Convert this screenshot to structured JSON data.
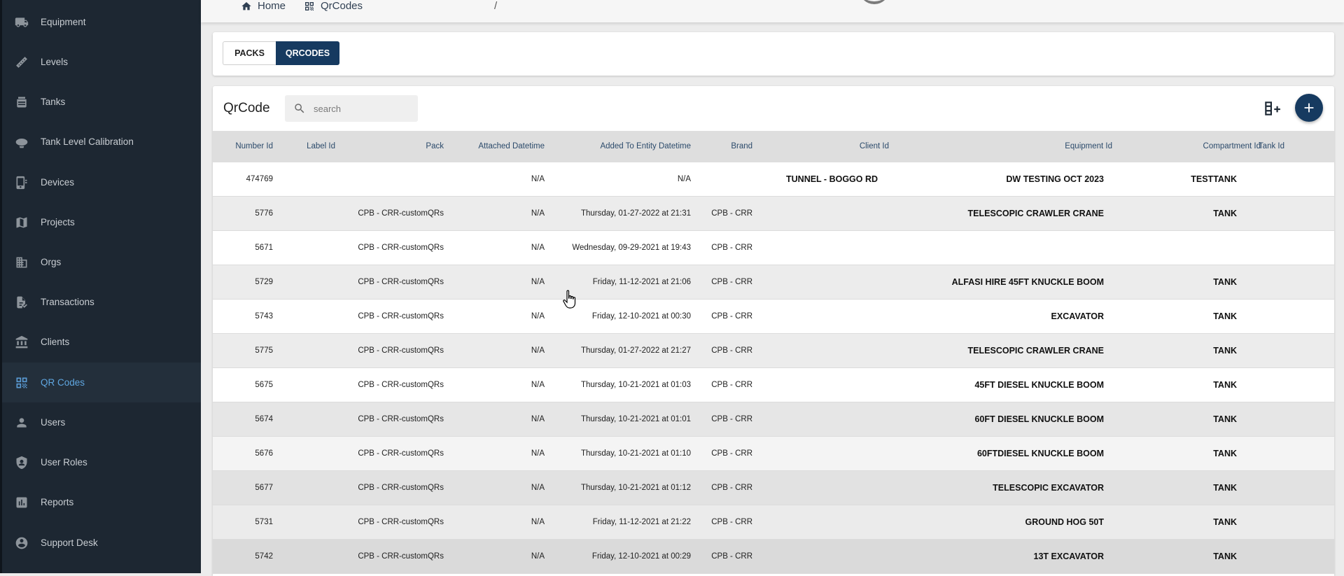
{
  "sidebar": {
    "items": [
      {
        "label": "Equipment",
        "icon": "truck-icon",
        "active": false
      },
      {
        "label": "Levels",
        "icon": "ruler-icon",
        "active": false
      },
      {
        "label": "Tanks",
        "icon": "tank-icon",
        "active": false
      },
      {
        "label": "Tank Level Calibration",
        "icon": "blimp-icon",
        "active": false
      },
      {
        "label": "Devices",
        "icon": "device-icon",
        "active": false
      },
      {
        "label": "Projects",
        "icon": "map-icon",
        "active": false
      },
      {
        "label": "Orgs",
        "icon": "building-icon",
        "active": false
      },
      {
        "label": "Transactions",
        "icon": "receipt-icon",
        "active": false
      },
      {
        "label": "Clients",
        "icon": "bank-icon",
        "active": false
      },
      {
        "label": "QR Codes",
        "icon": "qrcode-icon",
        "active": true
      },
      {
        "label": "Users",
        "icon": "person-icon",
        "active": false
      },
      {
        "label": "User Roles",
        "icon": "shield-icon",
        "active": false
      },
      {
        "label": "Reports",
        "icon": "chart-icon",
        "active": false
      },
      {
        "label": "Support Desk",
        "icon": "support-icon",
        "active": false
      }
    ]
  },
  "breadcrumb": {
    "home": "Home",
    "separator": "/",
    "current": "QrCodes"
  },
  "tabs": {
    "packs": "PACKS",
    "qrcodes": "QRCODES",
    "active": "QRCODES"
  },
  "main": {
    "title": "QrCode",
    "search_placeholder": "search",
    "search_value": ""
  },
  "colors": {
    "sidebar_bg": "#1d2732",
    "accent": "#163a60",
    "active_nav": "#5fa6e0",
    "header_text": "#2b4a6b"
  },
  "table": {
    "columns": [
      "Number Id",
      "Label Id",
      "Pack",
      "Attached Datetime",
      "Added To Entity Datetime",
      "Brand",
      "Client Id",
      "Equipment Id",
      "Compartment Id",
      "Tank Id"
    ],
    "rows": [
      {
        "number_id": "474769",
        "label_id": "",
        "pack": "",
        "attached": "N/A",
        "added": "N/A",
        "brand": "",
        "client": "TUNNEL - BOGGO RD",
        "equipment": "DW TESTING OCT 2023",
        "compartment": "TESTTANK",
        "tank": ""
      },
      {
        "number_id": "5776",
        "label_id": "",
        "pack": "CPB - CRR-customQRs",
        "attached": "N/A",
        "added": "Thursday, 01-27-2022 at 21:31",
        "brand": "CPB - CRR",
        "client": "",
        "equipment": "TELESCOPIC CRAWLER CRANE",
        "compartment": "TANK",
        "tank": ""
      },
      {
        "number_id": "5671",
        "label_id": "",
        "pack": "CPB - CRR-customQRs",
        "attached": "N/A",
        "added": "Wednesday, 09-29-2021 at 19:43",
        "brand": "CPB - CRR",
        "client": "",
        "equipment": "",
        "compartment": "",
        "tank": ""
      },
      {
        "number_id": "5729",
        "label_id": "",
        "pack": "CPB - CRR-customQRs",
        "attached": "N/A",
        "added": "Friday, 11-12-2021 at 21:06",
        "brand": "CPB - CRR",
        "client": "",
        "equipment": "ALFASI HIRE 45FT KNUCKLE BOOM",
        "compartment": "TANK",
        "tank": ""
      },
      {
        "number_id": "5743",
        "label_id": "",
        "pack": "CPB - CRR-customQRs",
        "attached": "N/A",
        "added": "Friday, 12-10-2021 at 00:30",
        "brand": "CPB - CRR",
        "client": "",
        "equipment": "EXCAVATOR",
        "compartment": "TANK",
        "tank": ""
      },
      {
        "number_id": "5775",
        "label_id": "",
        "pack": "CPB - CRR-customQRs",
        "attached": "N/A",
        "added": "Thursday, 01-27-2022 at 21:27",
        "brand": "CPB - CRR",
        "client": "",
        "equipment": "TELESCOPIC CRAWLER CRANE",
        "compartment": "TANK",
        "tank": ""
      },
      {
        "number_id": "5675",
        "label_id": "",
        "pack": "CPB - CRR-customQRs",
        "attached": "N/A",
        "added": "Thursday, 10-21-2021 at 01:03",
        "brand": "CPB - CRR",
        "client": "",
        "equipment": "45FT DIESEL KNUCKLE BOOM",
        "compartment": "TANK",
        "tank": ""
      },
      {
        "number_id": "5674",
        "label_id": "",
        "pack": "CPB - CRR-customQRs",
        "attached": "N/A",
        "added": "Thursday, 10-21-2021 at 01:01",
        "brand": "CPB - CRR",
        "client": "",
        "equipment": "60FT DIESEL KNUCKLE BOOM",
        "compartment": "TANK",
        "tank": ""
      },
      {
        "number_id": "5676",
        "label_id": "",
        "pack": "CPB - CRR-customQRs",
        "attached": "N/A",
        "added": "Thursday, 10-21-2021 at 01:10",
        "brand": "CPB - CRR",
        "client": "",
        "equipment": "60FTDIESEL KNUCKLE BOOM",
        "compartment": "TANK",
        "tank": ""
      },
      {
        "number_id": "5677",
        "label_id": "",
        "pack": "CPB - CRR-customQRs",
        "attached": "N/A",
        "added": "Thursday, 10-21-2021 at 01:12",
        "brand": "CPB - CRR",
        "client": "",
        "equipment": "TELESCOPIC EXCAVATOR",
        "compartment": "TANK",
        "tank": ""
      },
      {
        "number_id": "5731",
        "label_id": "",
        "pack": "CPB - CRR-customQRs",
        "attached": "N/A",
        "added": "Friday, 11-12-2021 at 21:22",
        "brand": "CPB - CRR",
        "client": "",
        "equipment": "GROUND HOG 50T",
        "compartment": "TANK",
        "tank": ""
      },
      {
        "number_id": "5742",
        "label_id": "",
        "pack": "CPB - CRR-customQRs",
        "attached": "N/A",
        "added": "Friday, 12-10-2021 at 00:29",
        "brand": "CPB - CRR",
        "client": "",
        "equipment": "13T EXCAVATOR",
        "compartment": "TANK",
        "tank": ""
      }
    ]
  }
}
